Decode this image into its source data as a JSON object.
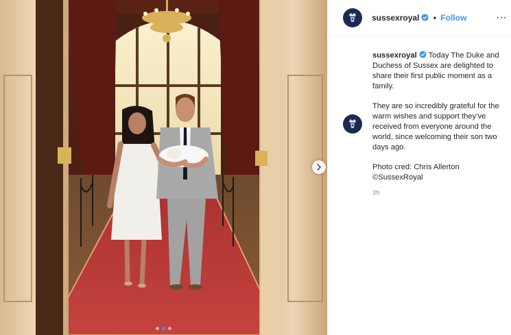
{
  "post": {
    "username": "sussexroyal",
    "follow_label": "Follow",
    "separator": "•",
    "more_label": "···",
    "caption": {
      "username": "sussexroyal",
      "paragraph1": "Today The Duke and Duchess of Sussex are delighted to share their first public moment as a family.",
      "paragraph2": "They are so incredibly grateful for the warm wishes and support they’ve received from everyone around the world, since welcoming their son two days ago.",
      "credit_line1": "Photo cred: Chris Allerton",
      "credit_line2": "©SussexRoyal"
    },
    "timestamp": "3h"
  },
  "carousel": {
    "current_index": 1,
    "total": 3
  },
  "colors": {
    "link_blue": "#3897f0",
    "avatar_navy": "#1c2a52",
    "verified_blue": "#3897f0",
    "carpet_red": "#b8393a"
  },
  "icons": {
    "next": "chevron-right-icon",
    "verified": "verified-badge-icon",
    "avatar": "crown-crest-icon",
    "more": "more-options-icon"
  }
}
